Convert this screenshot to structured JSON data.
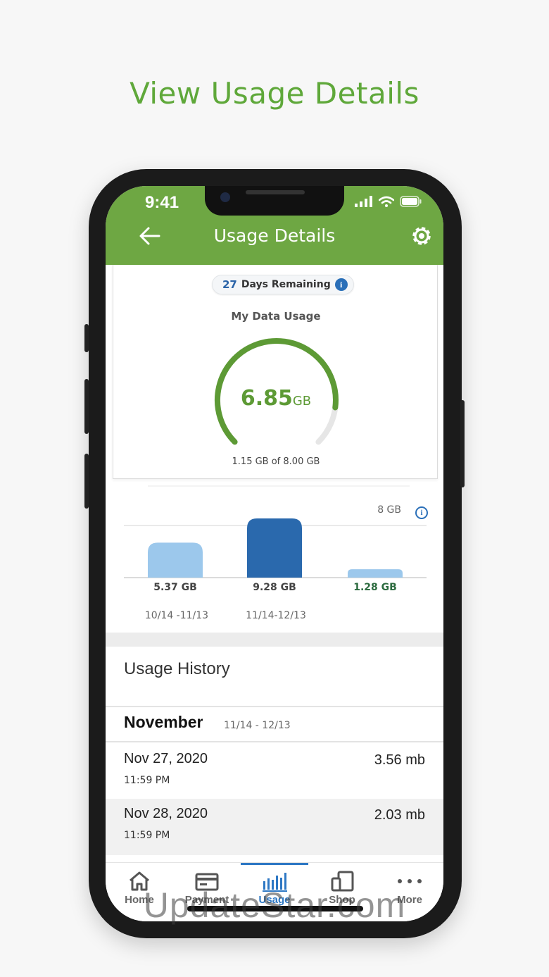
{
  "headline": "View Usage Details",
  "status": {
    "time": "9:41"
  },
  "nav": {
    "title": "Usage Details"
  },
  "summary": {
    "days_number": "27",
    "days_label": "Days Remaining",
    "info_glyph": "i",
    "section_label": "My Data Usage",
    "gauge_value": "6.85",
    "gauge_unit": "GB",
    "gauge_caption": "1.15  GB of 8.00 GB",
    "gauge_fraction": 0.86
  },
  "chart_data": {
    "type": "bar",
    "categories": [
      "10/14 -11/13",
      "11/14-12/13",
      ""
    ],
    "values": [
      5.37,
      9.28,
      1.28
    ],
    "value_labels": [
      "5.37 GB",
      "9.28 GB",
      "1.28 GB"
    ],
    "reference_label": "8 GB",
    "reference_value": 8,
    "colors": [
      "#9cc8ec",
      "#2a69ad",
      "#9cc8ec"
    ],
    "current_label_color": "#2c6b3f"
  },
  "history": {
    "title": "Usage History",
    "month": "November",
    "month_range": "11/14 - 12/13",
    "rows": [
      {
        "date": "Nov 27, 2020",
        "time": "11:59 PM",
        "amount": "3.56 mb"
      },
      {
        "date": "Nov 28, 2020",
        "time": "11:59 PM",
        "amount": "2.03 mb"
      }
    ]
  },
  "tabs": [
    {
      "label": "Home",
      "icon": "home-icon"
    },
    {
      "label": "Payment",
      "icon": "payment-card-icon"
    },
    {
      "label": "Usage",
      "icon": "usage-bars-icon",
      "active": true
    },
    {
      "label": "Shop",
      "icon": "devices-icon"
    },
    {
      "label": "More",
      "icon": "more-dots-icon"
    }
  ],
  "watermark": "UpdateStar.com",
  "colors": {
    "brand_green": "#6ea743",
    "accent_blue": "#2e78c4",
    "headline_green": "#5fa83a"
  }
}
